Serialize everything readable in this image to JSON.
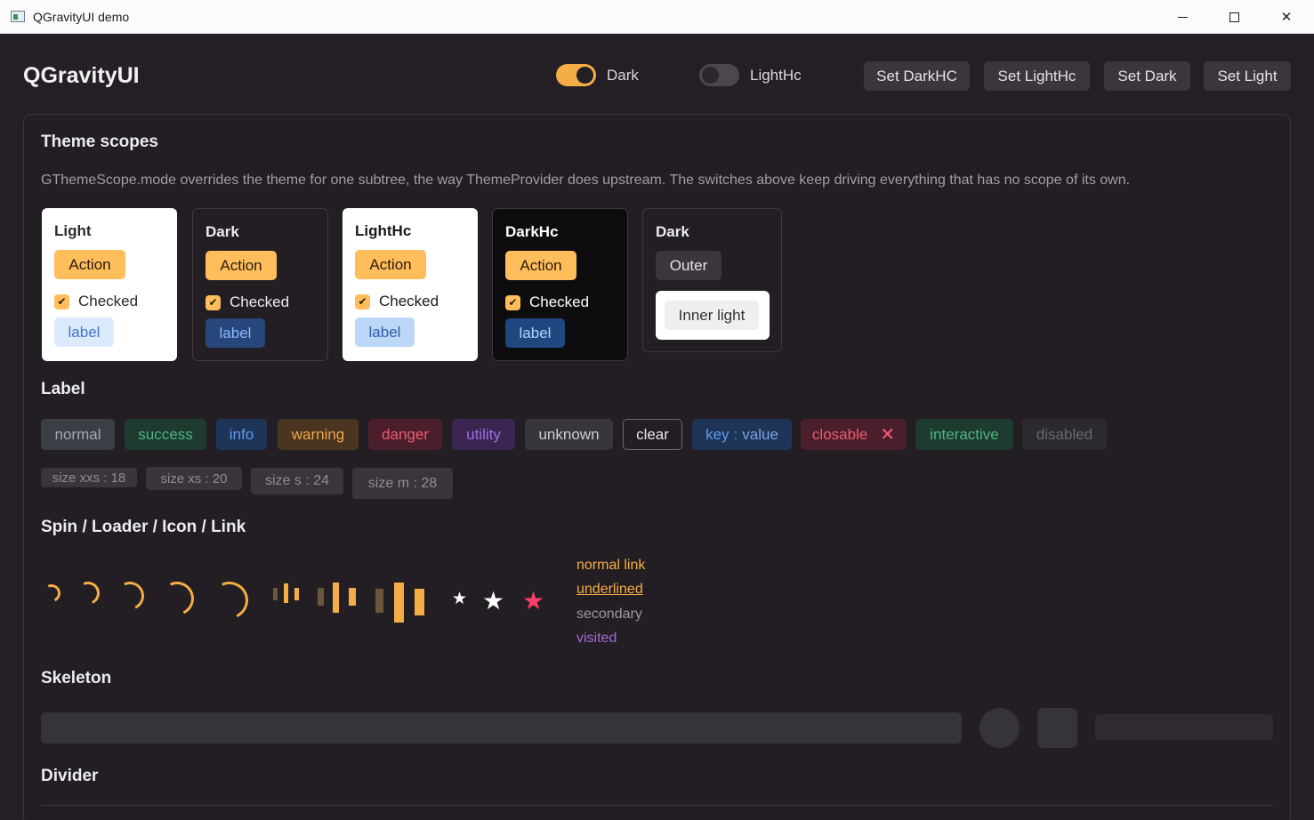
{
  "window": {
    "title": "QGravityUI demo",
    "minimize_icon": "minimize-icon",
    "maximize_icon": "maximize-icon",
    "close_glyph": "✕"
  },
  "header": {
    "app_title": "QGravityUI",
    "toggles": [
      {
        "label": "Dark",
        "on": true
      },
      {
        "label": "LightHc",
        "on": false
      }
    ],
    "buttons": [
      "Set DarkHC",
      "Set LightHc",
      "Set Dark",
      "Set Light"
    ]
  },
  "theme_scopes": {
    "heading": "Theme scopes",
    "description": "GThemeScope.mode overrides the theme for one subtree, the way ThemeProvider does upstream. The switches above keep driving everything that has no scope of its own.",
    "cards": [
      {
        "title": "Light",
        "action": "Action",
        "checkbox": "Checked",
        "checkmark": "✔",
        "label": "label"
      },
      {
        "title": "Dark",
        "action": "Action",
        "checkbox": "Checked",
        "checkmark": "✔",
        "label": "label"
      },
      {
        "title": "LightHc",
        "action": "Action",
        "checkbox": "Checked",
        "checkmark": "✔",
        "label": "label"
      },
      {
        "title": "DarkHc",
        "action": "Action",
        "checkbox": "Checked",
        "checkmark": "✔",
        "label": "label"
      }
    ],
    "nested": {
      "title": "Dark",
      "outer": "Outer",
      "inner": "Inner light"
    }
  },
  "labels": {
    "heading": "Label",
    "items": [
      {
        "text": "normal",
        "bg": "#3b3e45",
        "fg": "#a6a8ad"
      },
      {
        "text": "success",
        "bg": "#1d3b2e",
        "fg": "#4fb583"
      },
      {
        "text": "info",
        "bg": "#1f3558",
        "fg": "#5d9bf0"
      },
      {
        "text": "warning",
        "bg": "#4a3620",
        "fg": "#f0a64a"
      },
      {
        "text": "danger",
        "bg": "#4a1f2b",
        "fg": "#f05b74"
      },
      {
        "text": "utility",
        "bg": "#3a2650",
        "fg": "#9f6fe0"
      },
      {
        "text": "unknown",
        "bg": "#39363b",
        "fg": "#cfcdd2"
      },
      {
        "text": "clear",
        "bg": "transparent",
        "fg": "#e8e6ea"
      },
      {
        "key": "key",
        "sep": ":",
        "value": "value",
        "bg": "#1f3558"
      },
      {
        "text": "closable",
        "close": "✕",
        "bg": "#4a1f2b",
        "fg": "#f05b74"
      },
      {
        "text": "interactive",
        "bg": "#1d3b2e",
        "fg": "#4fb583"
      },
      {
        "text": "disabled",
        "bg": "#2d2a2f",
        "fg": "#6b686e"
      }
    ],
    "sizes": [
      {
        "name": "size xxs",
        "sep": ":",
        "value": "18"
      },
      {
        "name": "size xs",
        "sep": ":",
        "value": "20"
      },
      {
        "name": "size s",
        "sep": ":",
        "value": "24"
      },
      {
        "name": "size m",
        "sep": ":",
        "value": "28"
      }
    ]
  },
  "spin_section": {
    "heading": "Spin / Loader / Icon / Link",
    "star_glyph": "★",
    "links": {
      "normal": "normal link",
      "underlined": "underlined",
      "secondary": "secondary",
      "visited": "visited"
    },
    "colors": {
      "accent": "#f5ae45",
      "star_white": "#ffffff",
      "star_pink": "#ff3d6b",
      "visited": "#a46bd6",
      "secondary": "#9b989f"
    }
  },
  "skeleton": {
    "heading": "Skeleton"
  },
  "divider": {
    "heading": "Divider"
  }
}
